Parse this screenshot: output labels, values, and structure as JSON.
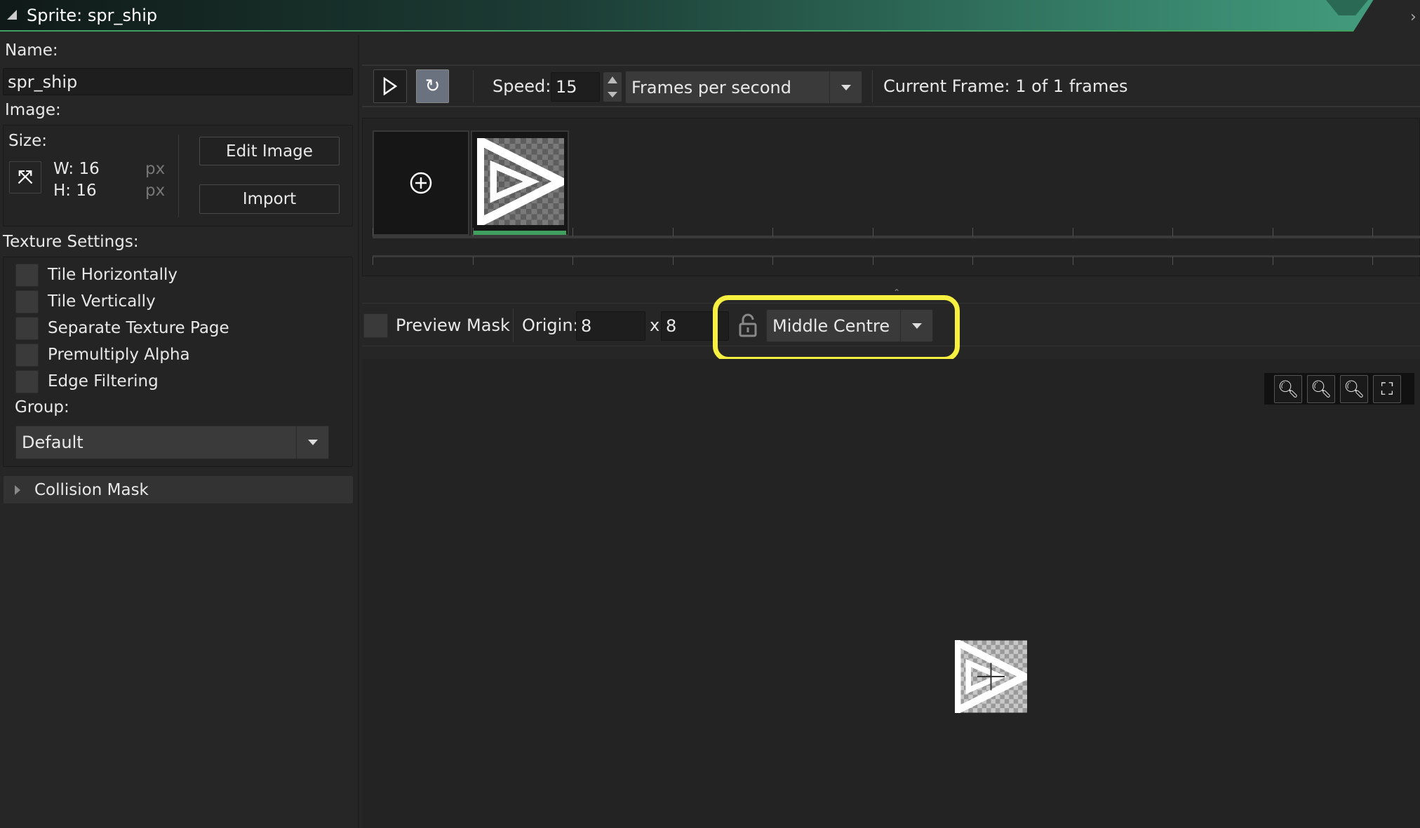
{
  "window": {
    "title": "Sprite: spr_ship"
  },
  "left": {
    "name_label": "Name:",
    "name_value": "spr_ship",
    "image_label": "Image:",
    "size_label": "Size:",
    "width": "W: 16",
    "height": "H: 16",
    "unit": "px",
    "edit_image": "Edit Image",
    "import": "Import",
    "texture_label": "Texture Settings:",
    "options": [
      {
        "label": "Tile Horizontally",
        "checked": false
      },
      {
        "label": "Tile Vertically",
        "checked": false
      },
      {
        "label": "Separate Texture Page",
        "checked": false
      },
      {
        "label": "Premultiply Alpha",
        "checked": false
      },
      {
        "label": "Edge Filtering",
        "checked": false
      }
    ],
    "group_label": "Group:",
    "group_value": "Default",
    "collision_mask": "Collision Mask"
  },
  "toolbar": {
    "speed_label": "Speed:",
    "speed_value": "15",
    "speed_unit": "Frames per second",
    "current_frame": "Current Frame: 1 of 1 frames"
  },
  "origin": {
    "preview_mask": "Preview Mask",
    "origin_label": "Origin:",
    "x": "8",
    "x_sep": "x",
    "y": "8",
    "preset": "Middle Centre"
  },
  "colors": {
    "accent": "#3fa060",
    "highlight": "#f8f040"
  }
}
